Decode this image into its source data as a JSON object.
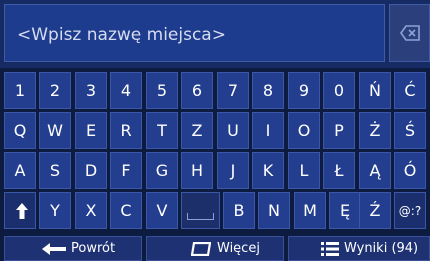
{
  "search": {
    "placeholder_text": "<Wpisz nazwę miejsca>"
  },
  "keyboard": {
    "rows": [
      [
        "1",
        "2",
        "3",
        "4",
        "5",
        "6",
        "7",
        "8",
        "9",
        "0",
        "Ń",
        "Ć"
      ],
      [
        "Q",
        "W",
        "E",
        "R",
        "T",
        "Z",
        "U",
        "I",
        "O",
        "P",
        "Ż",
        "Ś"
      ],
      [
        "A",
        "S",
        "D",
        "F",
        "G",
        "H",
        "J",
        "K",
        "L",
        "Ł",
        "Ą",
        "Ó"
      ],
      [
        "Y",
        "X",
        "C",
        "V",
        "B",
        "N",
        "M",
        "Ę",
        "Ź",
        "@:?"
      ]
    ]
  },
  "bottom_bar": {
    "back_label": "Powrót",
    "more_label": "Więcej",
    "results_label": "Wyniki (94)"
  },
  "icons": [
    "backspace-icon",
    "shift-icon",
    "space-icon",
    "back-arrow-icon",
    "more-icon",
    "list-icon"
  ],
  "colors": {
    "key_bg": "#243e8f",
    "input_bg": "#1e3c8d",
    "screen_bg": "#0e1b40"
  }
}
